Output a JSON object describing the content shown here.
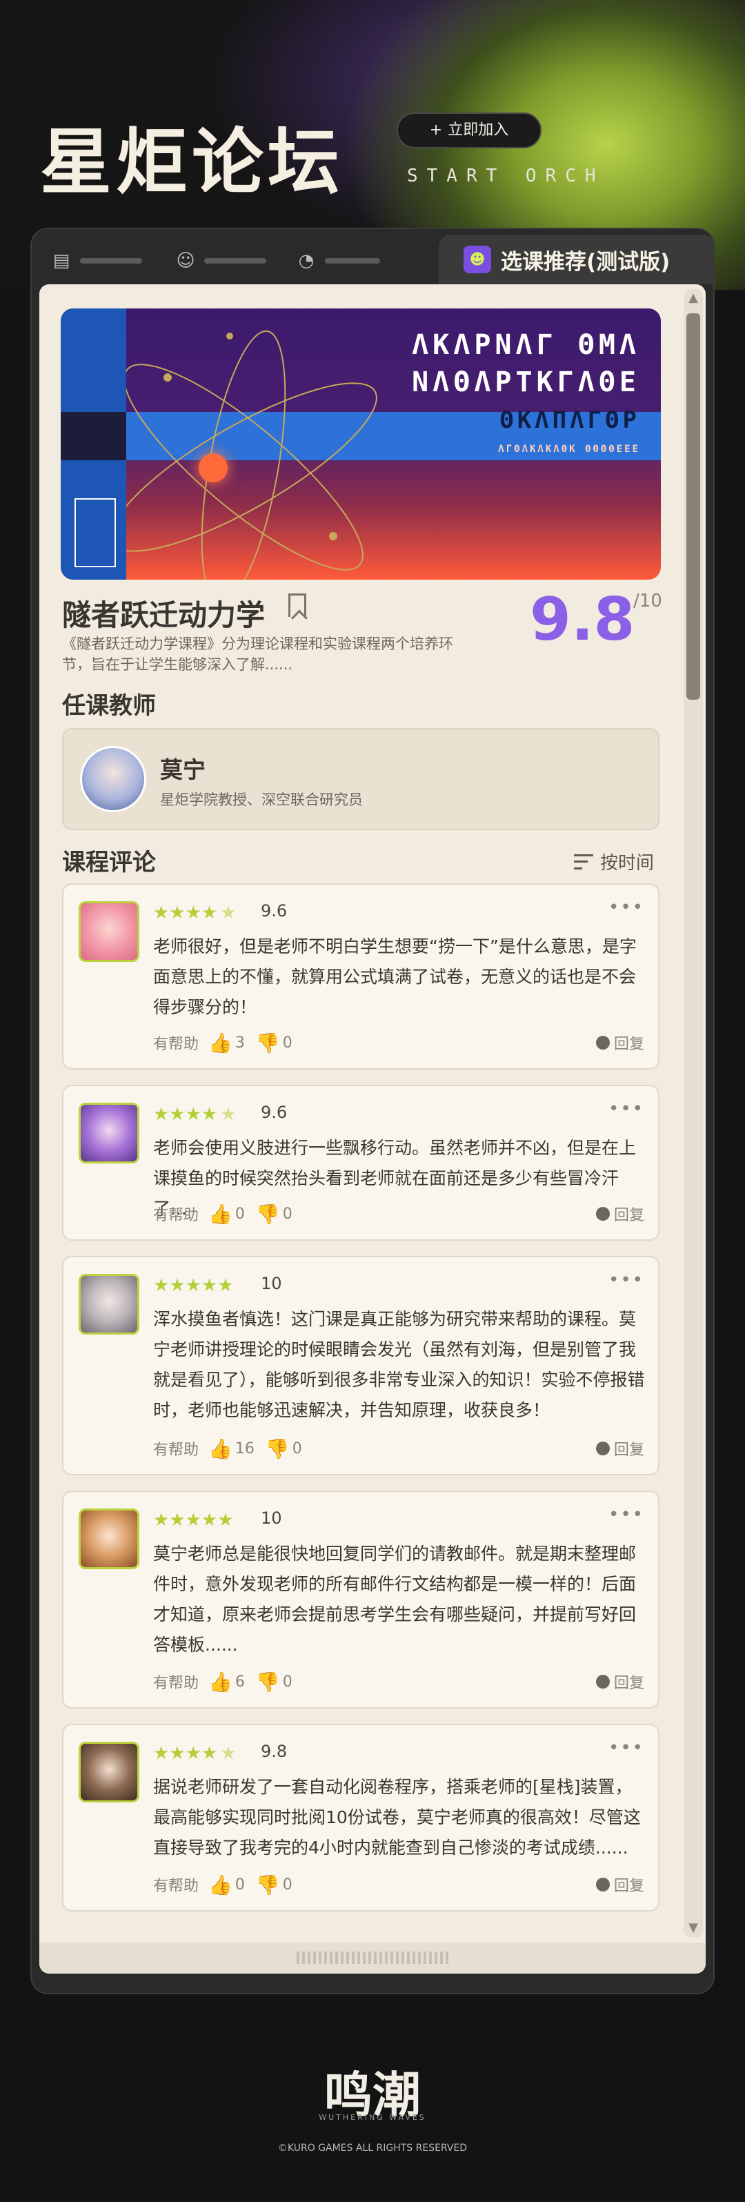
{
  "header": {
    "title": "星炬论坛",
    "join_button": "立即加入",
    "join_plus": "+",
    "tagline": "START ORCH"
  },
  "tabs": {
    "items": [
      {
        "icon": "document-icon"
      },
      {
        "icon": "face-icon"
      },
      {
        "icon": "chat-icon"
      }
    ],
    "active_label": "选课推荐(测试版)"
  },
  "course": {
    "banner_lines": [
      "ΛΚΛΡΝΛΓ ΘΜΛ",
      "ΝΛΘΛΡΤΚΓΛΘΕ",
      "ΘΚΛΠΛΓΘΡ",
      "ΛΓΘΛΚΛΚΛΘΚ ΘΘΘΘΕΕΕ"
    ],
    "title": "隧者跃迁动力学",
    "description": "《隧者跃迁动力学课程》分为理论课程和实验课程两个培养环节，旨在于让学生能够深入了解......",
    "score": "9.8",
    "score_max": "/10"
  },
  "teacher_section": {
    "heading": "任课教师",
    "name": "莫宁",
    "title": "星炬学院教授、深空联合研究员"
  },
  "reviews": {
    "heading": "课程评论",
    "sort_label": "按时间",
    "helpful_label": "有帮助",
    "reply_label": "回复",
    "items": [
      {
        "rating": "9.6",
        "stars": 4.5,
        "text": "老师很好，但是老师不明白学生想要“捞一下”是什么意思，是字面意思上的不懂，就算用公式填满了试卷，无意义的话也是不会得步骤分的！",
        "likes": "3",
        "dislikes": "0"
      },
      {
        "rating": "9.6",
        "stars": 4.5,
        "text": "老师会使用义肢进行一些飘移行动。虽然老师并不凶，但是在上课摸鱼的时候突然抬头看到老师就在面前还是多少有些冒冷汗了...",
        "likes": "0",
        "dislikes": "0"
      },
      {
        "rating": "10",
        "stars": 5,
        "text": "浑水摸鱼者慎选！这门课是真正能够为研究带来帮助的课程。莫宁老师讲授理论的时候眼睛会发光（虽然有刘海，但是别管了我就是看见了），能够听到很多非常专业深入的知识！实验不停报错时，老师也能够迅速解决，并告知原理，收获良多！",
        "likes": "16",
        "dislikes": "0"
      },
      {
        "rating": "10",
        "stars": 5,
        "text": "莫宁老师总是能很快地回复同学们的请教邮件。就是期末整理邮件时，意外发现老师的所有邮件行文结构都是一模一样的！后面才知道，原来老师会提前思考学生会有哪些疑问，并提前写好回答模板......",
        "likes": "6",
        "dislikes": "0"
      },
      {
        "rating": "9.8",
        "stars": 4.5,
        "text": "据说老师研发了一套自动化阅卷程序，搭乘老师的[星栈]装置，最高能够实现同时批阅10份试卷，莫宁老师真的很高效！尽管这直接导致了我考完的4小时内就能查到自己惨淡的考试成绩......",
        "likes": "0",
        "dislikes": "0"
      }
    ]
  },
  "footer": {
    "logo": "鸣潮",
    "logo_sub": "WUTHERING WAVES",
    "copyright": "©KURO GAMES ALL RIGHTS RESERVED"
  },
  "colors": {
    "accent_purple": "#8b5fe6",
    "accent_green": "#b3cf3a",
    "panel_bg": "#f2ece0",
    "dislike_red": "#c0392b"
  }
}
